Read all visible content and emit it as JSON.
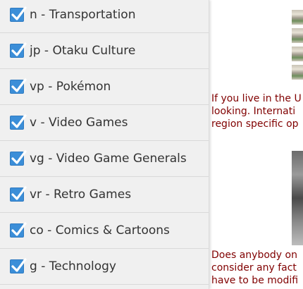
{
  "boards": [
    {
      "label": "n - Transportation",
      "checked": true
    },
    {
      "label": "jp - Otaku Culture",
      "checked": true
    },
    {
      "label": "vp - Pokémon",
      "checked": true
    },
    {
      "label": "v - Video Games",
      "checked": true
    },
    {
      "label": "vg - Video Game Generals",
      "checked": true
    },
    {
      "label": "vr - Retro Games",
      "checked": true
    },
    {
      "label": "co - Comics & Cartoons",
      "checked": true
    },
    {
      "label": "g - Technology",
      "checked": true
    }
  ],
  "thread": {
    "post1_lines": [
      "If you live in the U",
      "looking. Internati",
      "region specific op"
    ],
    "post2_lines": [
      "Does anybody on",
      "consider any fact",
      "have to be modifi"
    ]
  },
  "colors": {
    "checkbox": "#3b8ed8",
    "post_text": "#800000",
    "drawer_bg": "#f0f0f0"
  }
}
